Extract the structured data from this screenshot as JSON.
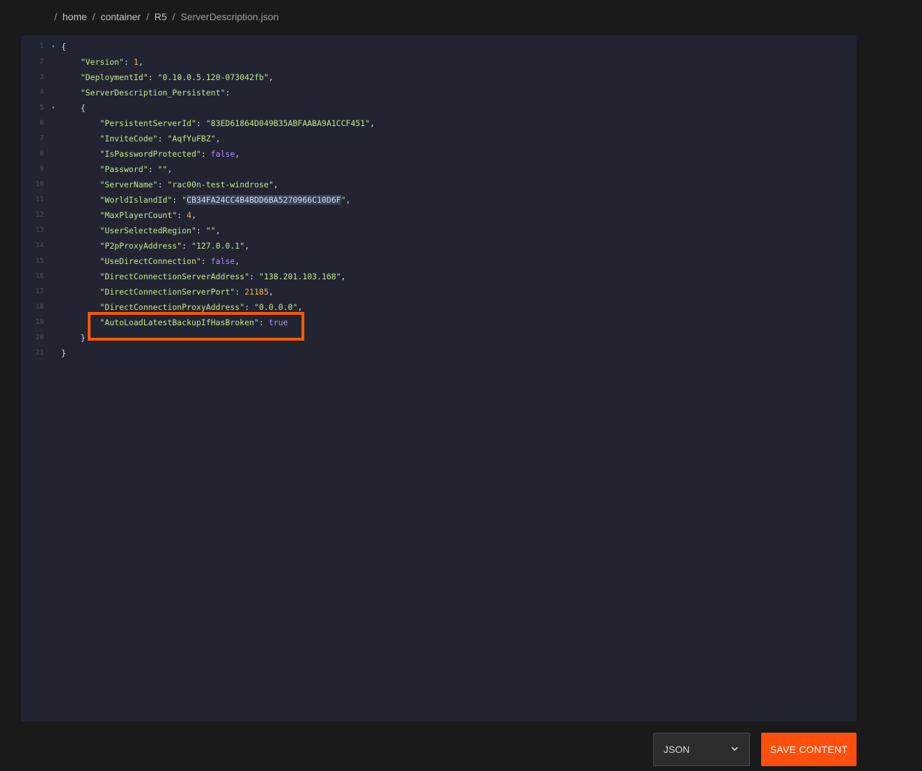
{
  "breadcrumb": {
    "separator": "/",
    "items": [
      "home",
      "container",
      "R5",
      "ServerDescription.json"
    ]
  },
  "editor": {
    "lines": [
      {
        "n": "1",
        "fold": true,
        "parts": [
          [
            "p",
            "{"
          ]
        ]
      },
      {
        "n": "2",
        "fold": false,
        "parts": [
          [
            "p",
            "    "
          ],
          [
            "k",
            "\"Version\""
          ],
          [
            "p",
            ": "
          ],
          [
            "n",
            "1"
          ],
          [
            "p",
            ","
          ]
        ]
      },
      {
        "n": "3",
        "fold": false,
        "parts": [
          [
            "p",
            "    "
          ],
          [
            "k",
            "\"DeploymentId\""
          ],
          [
            "p",
            ": "
          ],
          [
            "s",
            "\"0.10.0.5.120-073042fb\""
          ],
          [
            "p",
            ","
          ]
        ]
      },
      {
        "n": "4",
        "fold": false,
        "parts": [
          [
            "p",
            "    "
          ],
          [
            "k",
            "\"ServerDescription_Persistent\""
          ],
          [
            "p",
            ":"
          ]
        ]
      },
      {
        "n": "5",
        "fold": true,
        "parts": [
          [
            "p",
            "    {"
          ]
        ]
      },
      {
        "n": "6",
        "fold": false,
        "parts": [
          [
            "p",
            "        "
          ],
          [
            "k",
            "\"PersistentServerId\""
          ],
          [
            "p",
            ": "
          ],
          [
            "s",
            "\"83ED61864D049B35ABFAABA9A1CCF451\""
          ],
          [
            "p",
            ","
          ]
        ]
      },
      {
        "n": "7",
        "fold": false,
        "parts": [
          [
            "p",
            "        "
          ],
          [
            "k",
            "\"InviteCode\""
          ],
          [
            "p",
            ": "
          ],
          [
            "s",
            "\"AqfYuFBZ\""
          ],
          [
            "p",
            ","
          ]
        ]
      },
      {
        "n": "8",
        "fold": false,
        "parts": [
          [
            "p",
            "        "
          ],
          [
            "k",
            "\"IsPasswordProtected\""
          ],
          [
            "p",
            ": "
          ],
          [
            "b",
            "false"
          ],
          [
            "p",
            ","
          ]
        ]
      },
      {
        "n": "9",
        "fold": false,
        "parts": [
          [
            "p",
            "        "
          ],
          [
            "k",
            "\"Password\""
          ],
          [
            "p",
            ": "
          ],
          [
            "s",
            "\"\""
          ],
          [
            "p",
            ","
          ]
        ]
      },
      {
        "n": "10",
        "fold": false,
        "parts": [
          [
            "p",
            "        "
          ],
          [
            "k",
            "\"ServerName\""
          ],
          [
            "p",
            ": "
          ],
          [
            "s",
            "\"rac00n-test-windrose\""
          ],
          [
            "p",
            ","
          ]
        ]
      },
      {
        "n": "11",
        "fold": false,
        "parts": [
          [
            "p",
            "        "
          ],
          [
            "k",
            "\"WorldIslandId\""
          ],
          [
            "p",
            ": "
          ],
          [
            "s",
            "\""
          ],
          [
            "sel",
            "CB34FA24CC4B4BDD6BA5270966C10D6F"
          ],
          [
            "s",
            "\""
          ],
          [
            "p",
            ","
          ]
        ]
      },
      {
        "n": "12",
        "fold": false,
        "parts": [
          [
            "p",
            "        "
          ],
          [
            "k",
            "\"MaxPlayerCount\""
          ],
          [
            "p",
            ": "
          ],
          [
            "n",
            "4"
          ],
          [
            "p",
            ","
          ]
        ]
      },
      {
        "n": "13",
        "fold": false,
        "parts": [
          [
            "p",
            "        "
          ],
          [
            "k",
            "\"UserSelectedRegion\""
          ],
          [
            "p",
            ": "
          ],
          [
            "s",
            "\"\""
          ],
          [
            "p",
            ","
          ]
        ]
      },
      {
        "n": "14",
        "fold": false,
        "parts": [
          [
            "p",
            "        "
          ],
          [
            "k",
            "\"P2pProxyAddress\""
          ],
          [
            "p",
            ": "
          ],
          [
            "s",
            "\"127.0.0.1\""
          ],
          [
            "p",
            ","
          ]
        ]
      },
      {
        "n": "15",
        "fold": false,
        "parts": [
          [
            "p",
            "        "
          ],
          [
            "k",
            "\"UseDirectConnection\""
          ],
          [
            "p",
            ": "
          ],
          [
            "b",
            "false"
          ],
          [
            "p",
            ","
          ]
        ]
      },
      {
        "n": "16",
        "fold": false,
        "parts": [
          [
            "p",
            "        "
          ],
          [
            "k",
            "\"DirectConnectionServerAddress\""
          ],
          [
            "p",
            ": "
          ],
          [
            "s",
            "\"138.201.103.168\""
          ],
          [
            "p",
            ","
          ]
        ]
      },
      {
        "n": "17",
        "fold": false,
        "parts": [
          [
            "p",
            "        "
          ],
          [
            "k",
            "\"DirectConnectionServerPort\""
          ],
          [
            "p",
            ": "
          ],
          [
            "n",
            "21185"
          ],
          [
            "p",
            ","
          ]
        ]
      },
      {
        "n": "18",
        "fold": false,
        "parts": [
          [
            "p",
            "        "
          ],
          [
            "k",
            "\"DirectConnectionProxyAddress\""
          ],
          [
            "p",
            ": "
          ],
          [
            "s",
            "\"0.0.0.0\""
          ],
          [
            "p",
            ","
          ]
        ]
      },
      {
        "n": "19",
        "fold": false,
        "parts": [
          [
            "p",
            "        "
          ],
          [
            "k",
            "\"AutoLoadLatestBackupIfHasBroken\""
          ],
          [
            "p",
            ": "
          ],
          [
            "b",
            "true"
          ]
        ]
      },
      {
        "n": "20",
        "fold": false,
        "parts": [
          [
            "p",
            "    }"
          ]
        ]
      },
      {
        "n": "21",
        "fold": false,
        "parts": [
          [
            "p",
            "}"
          ]
        ]
      }
    ]
  },
  "footer": {
    "format_select": {
      "selected": "JSON",
      "icon": "chevron-down-icon"
    },
    "save_label": "SAVE CONTENT"
  },
  "colors": {
    "accent": "#ff4f0f",
    "highlight_box": "#ff5a00",
    "editor_bg": "#222531"
  }
}
